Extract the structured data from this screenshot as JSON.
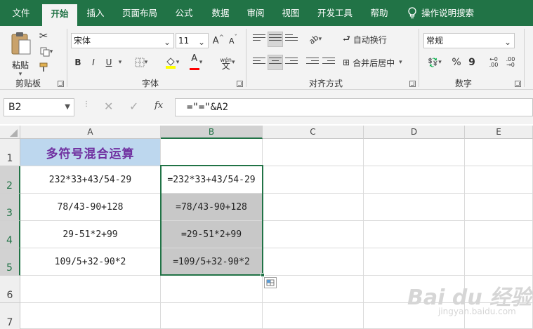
{
  "menu": {
    "tabs": [
      "文件",
      "开始",
      "插入",
      "页面布局",
      "公式",
      "数据",
      "审阅",
      "视图",
      "开发工具",
      "帮助"
    ],
    "active_tab": "开始",
    "tell_me": "操作说明搜索"
  },
  "ribbon": {
    "clipboard": {
      "paste_label": "粘贴",
      "group_label": "剪贴板"
    },
    "font": {
      "font_name": "宋体",
      "font_size": "11",
      "grow_label": "A",
      "shrink_label": "A",
      "bold": "B",
      "italic": "I",
      "underline": "U",
      "font_color_label": "A",
      "wen_label": "wén",
      "group_label": "字体"
    },
    "alignment": {
      "wrap_text": "自动换行",
      "merge_center": "合并后居中",
      "group_label": "对齐方式"
    },
    "number": {
      "format": "常规",
      "percent": "%",
      "comma": "9",
      "dec_inc": ".00",
      "dec_dec": ".00",
      "group_label": "数字"
    },
    "colors": {
      "accent": "#217346",
      "title_fill": "#BDD7EE",
      "title_text": "#7030A0",
      "selection_fill": "#C8C8C8"
    }
  },
  "formula_bar": {
    "name_box": "B2",
    "fx_label": "fx",
    "formula": "=\"=\"&A2"
  },
  "grid": {
    "columns": [
      "A",
      "B",
      "C",
      "D",
      "E"
    ],
    "rows": [
      "1",
      "2",
      "3",
      "4",
      "5",
      "6",
      "7"
    ],
    "A1": "多符号混合运算",
    "col_a": [
      "232*33+43/54-29",
      "78/43-90+128",
      "29-51*2+99",
      "109/5+32-90*2"
    ],
    "col_b": [
      "=232*33+43/54-29",
      "=78/43-90+128",
      "=29-51*2+99",
      "=109/5+32-90*2"
    ]
  },
  "watermark": {
    "brand": "Bai du 经验",
    "url": "jingyan.baidu.com"
  }
}
